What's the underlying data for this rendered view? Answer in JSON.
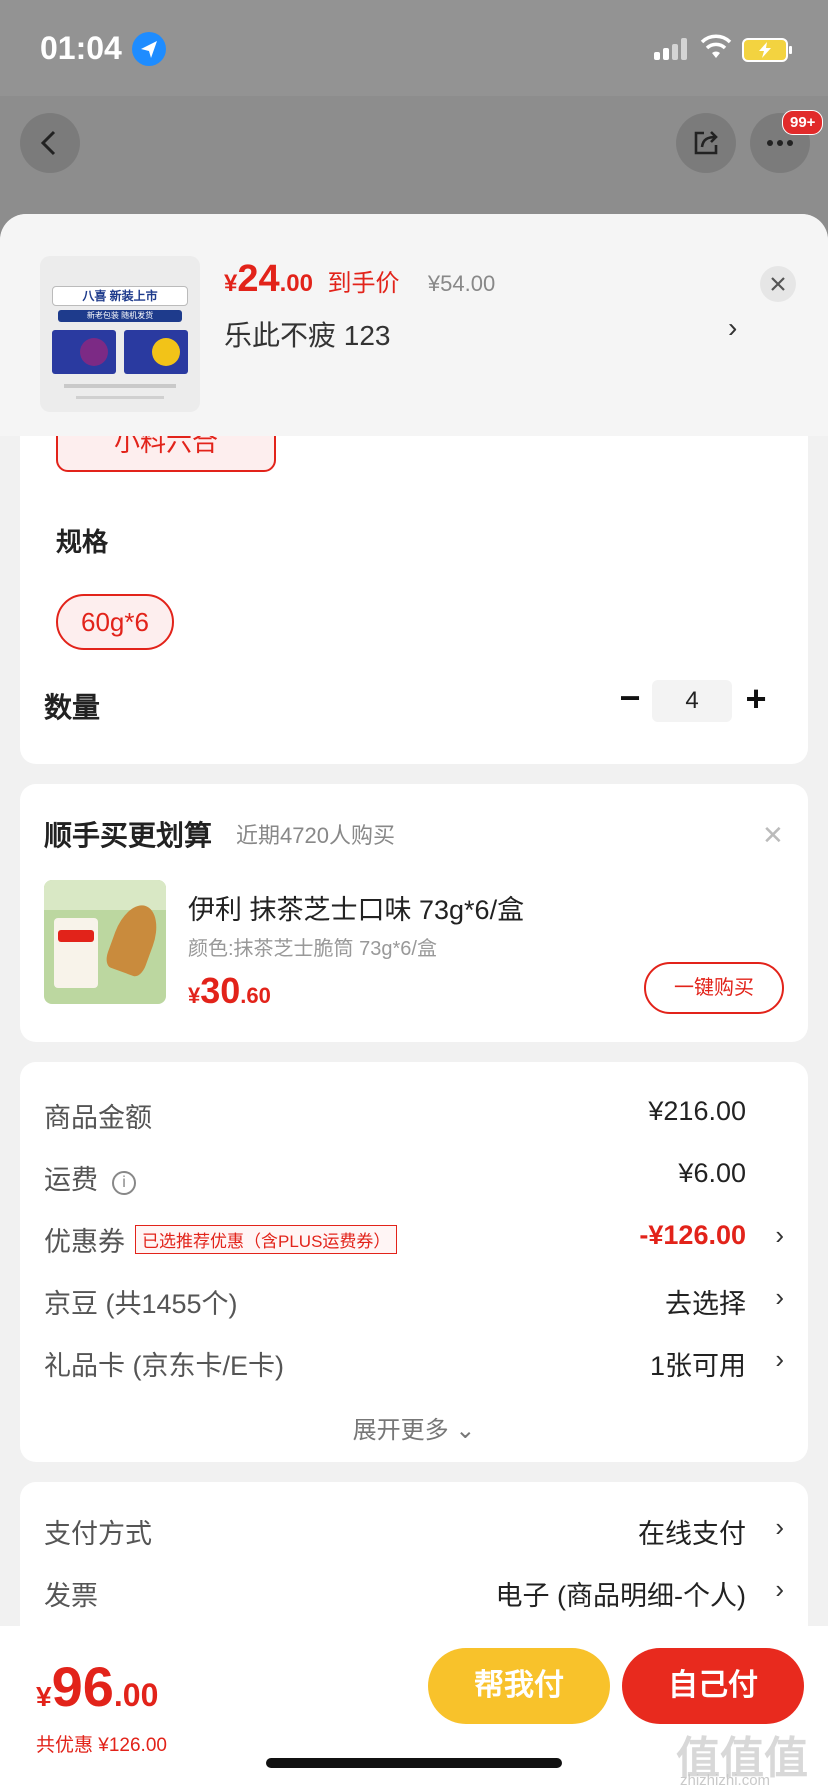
{
  "status_bar": {
    "time": "01:04"
  },
  "nav": {
    "badge": "99+"
  },
  "product": {
    "price_currency": "¥",
    "price_int": "24",
    "price_dec": ".00",
    "price_label": "到手价",
    "original_price": "¥54.00",
    "variant": "乐此不疲  123",
    "thumb_title": "八喜 新装上市",
    "thumb_sub": "新老包装 随机发货"
  },
  "spec": {
    "flavor_chip": "小料六合",
    "spec_label": "规格",
    "spec_option": "60g*6",
    "quantity_label": "数量",
    "minus": "−",
    "quantity": "4",
    "plus": "+"
  },
  "upsell": {
    "title": "顺手买更划算",
    "subtitle": "近期4720人购买",
    "close": "✕",
    "name": "伊利 抹茶芝士口味 73g*6/盒",
    "color": "颜色:抹茶芝士脆筒 73g*6/盒",
    "price_currency": "¥",
    "price_int": "30",
    "price_dec": ".60",
    "button": "一键购买"
  },
  "summary": {
    "rows": [
      {
        "label": "商品金额",
        "value": "¥216.00"
      },
      {
        "label": "运费",
        "value": "¥6.00",
        "info": "i"
      },
      {
        "label": "优惠券",
        "tag": "已选推荐优惠（含PLUS运费券）",
        "value": "-¥126.00"
      },
      {
        "label": "京豆 (共1455个)",
        "value": "去选择"
      },
      {
        "label": "礼品卡 (京东卡/E卡)",
        "value": "1张可用"
      }
    ],
    "expand": "展开更多 ⌄"
  },
  "payment": {
    "rows": [
      {
        "label": "支付方式",
        "value": "在线支付"
      },
      {
        "label": "发票",
        "value": "电子 (商品明细-个人)"
      }
    ]
  },
  "bottom": {
    "currency": "¥",
    "total_int": "96",
    "total_dec": ".00",
    "saved": "共优惠 ¥126.00",
    "help_pay": "帮我付",
    "self_pay": "自己付",
    "watermark": "值值值",
    "watermark_sub": "zhizhizhi.com"
  },
  "colors": {
    "accent_red": "#e2231a",
    "help_pay_yellow": "#f8c22b"
  }
}
